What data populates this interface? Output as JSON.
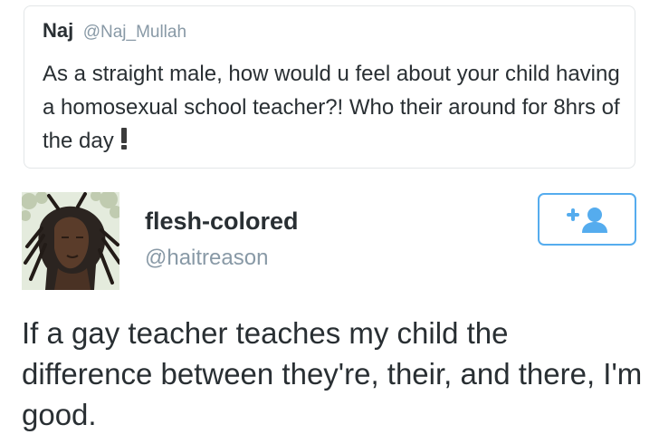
{
  "quoted_tweet": {
    "name": "Naj",
    "handle": "@Naj_Mullah",
    "text": "As a straight male, how would u feel about your child having a homosexual school teacher?! Who their around for 8hrs of the day",
    "emoji": "heavy-exclamation-mark"
  },
  "tweet": {
    "author_name": "flesh-colored",
    "author_handle": "@haitreason",
    "text": "If a gay teacher teaches my child the difference between they're, their, and there, I'm good.",
    "follow_icon": "add-user-icon"
  },
  "colors": {
    "accent": "#55acee",
    "text": "#292f33",
    "muted": "#8899a6",
    "border": "#e3e6e8"
  }
}
